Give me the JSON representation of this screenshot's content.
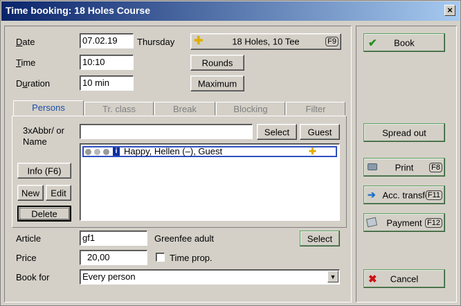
{
  "window": {
    "title": "Time booking: 18 Holes Course",
    "close_symbol": "×"
  },
  "form": {
    "date_label": "Date",
    "date_value": "07.02.19",
    "weekday": "Thursday",
    "time_label": "Time",
    "time_value": "10:10",
    "duration_label": "Duration",
    "duration_value": "10 min"
  },
  "top_buttons": {
    "holes": {
      "label": "18 Holes, 10 Tee",
      "key": "F9"
    },
    "rounds": "Rounds",
    "maximum": "Maximum"
  },
  "tabs": [
    "Persons",
    "Tr. class",
    "Break",
    "Blocking",
    "Filter"
  ],
  "persons": {
    "search_label_1": "3xAbbr/ or",
    "search_label_2": "Name",
    "search_value": "",
    "select_button": "Select",
    "guest_button": "Guest",
    "info_button": "Info (F6)",
    "new_button": "New",
    "edit_button": "Edit",
    "delete_button": "Delete",
    "list": [
      {
        "name": "Happy, Hellen (–), Guest"
      }
    ]
  },
  "article": {
    "article_label": "Article",
    "article_value": "gf1",
    "article_desc": "Greenfee adult",
    "select_button": "Select",
    "price_label": "Price",
    "price_value": "20,00",
    "time_prop_label": "Time prop.",
    "book_for_label": "Book for",
    "book_for_value": "Every person"
  },
  "side_buttons": {
    "book": "Book",
    "spread_out": "Spread out",
    "print": {
      "label": "Print",
      "key": "F8"
    },
    "acc_transfer": {
      "label": "Acc. transfer",
      "key": "F11"
    },
    "payment": {
      "label": "Payment",
      "key": "F12"
    },
    "cancel": "Cancel"
  },
  "colors": {
    "title_bar": "#0a246a",
    "selection_border": "#2f4fc0",
    "tab_active": "#1c4fa8",
    "check_green": "#1f8f1f",
    "cancel_red": "#d01010"
  }
}
